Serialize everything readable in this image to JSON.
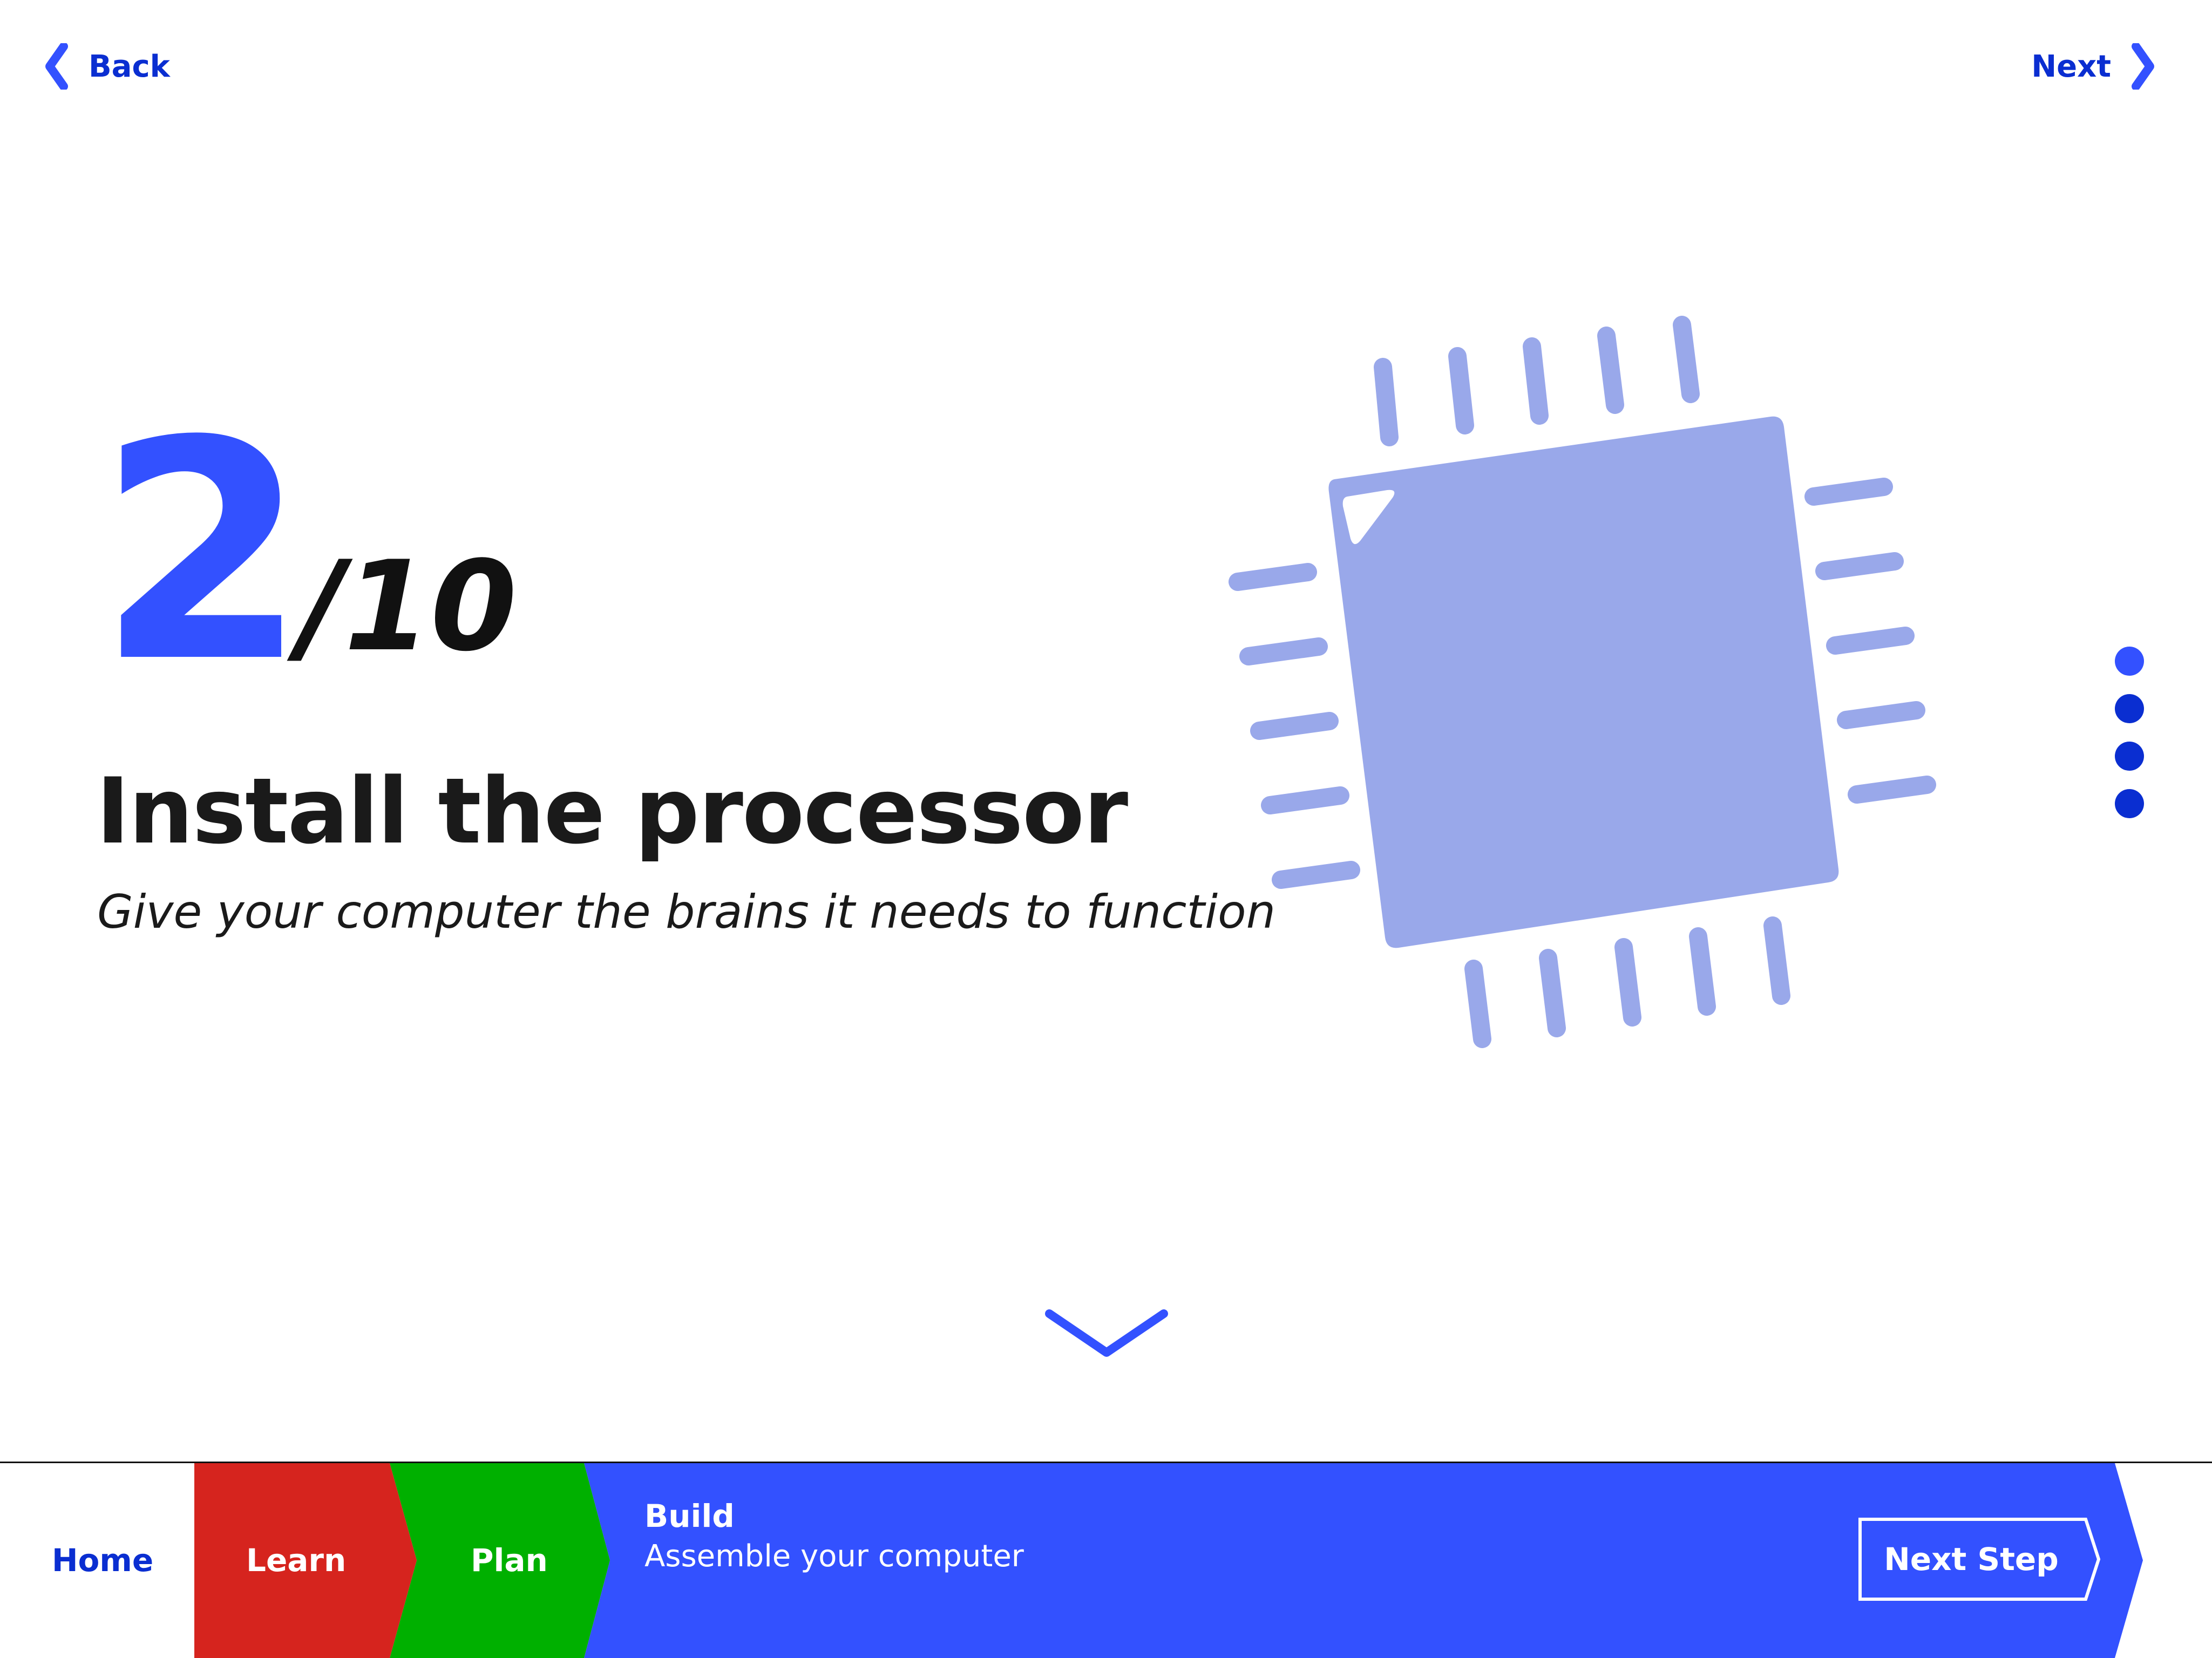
{
  "nav": {
    "back_label": "Back",
    "next_label": "Next"
  },
  "step": {
    "current": "2",
    "total": "/10",
    "title": "Install the processor",
    "subtitle": "Give your computer the brains it needs to function"
  },
  "illustration": {
    "icon": "processor-chip-icon",
    "color": "#99a8ea"
  },
  "progress_dots": {
    "count": 4,
    "active_index": 0
  },
  "breadcrumb": {
    "home": "Home",
    "learn": "Learn",
    "plan": "Plan",
    "build_title": "Build",
    "build_subtitle": "Assemble your computer",
    "next_step": "Next Step"
  },
  "colors": {
    "accent_blue": "#3351ff",
    "dark_blue": "#0a2ed1",
    "learn_red": "#d6241e",
    "plan_green": "#00b000"
  }
}
